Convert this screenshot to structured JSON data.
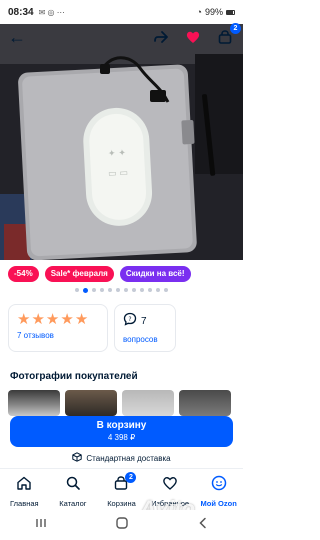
{
  "status_bar": {
    "time": "08:34",
    "battery": "99%"
  },
  "product": {
    "badges": {
      "discount": "-54%",
      "sale": "Sale* февраля",
      "promo": "Скидки на всё!"
    },
    "gallery": {
      "total": 12,
      "active_index": 1
    },
    "header": {
      "cart_count": "2"
    }
  },
  "rating": {
    "stars": 5,
    "reviews_label": "7 отзывов"
  },
  "questions": {
    "count": "7",
    "label": "вопросов"
  },
  "customer_photos": {
    "title": "Фотографии покупателей"
  },
  "cart_button": {
    "label": "В корзину",
    "price": "4 398 ₽"
  },
  "delivery": {
    "label": "Стандартная доставка"
  },
  "bottom_nav": {
    "items": [
      {
        "label": "Главная",
        "icon": "home-icon"
      },
      {
        "label": "Каталог",
        "icon": "search-icon"
      },
      {
        "label": "Корзина",
        "icon": "cart-icon",
        "badge": "2"
      },
      {
        "label": "Избранное",
        "icon": "heart-icon"
      },
      {
        "label": "Мой Ozon",
        "icon": "profile-icon"
      }
    ]
  },
  "watermark": "Avito",
  "colors": {
    "accent": "#005bff",
    "discount": "#f91155",
    "promo": "#7a2ff0",
    "stars": "#ff9a5c"
  }
}
